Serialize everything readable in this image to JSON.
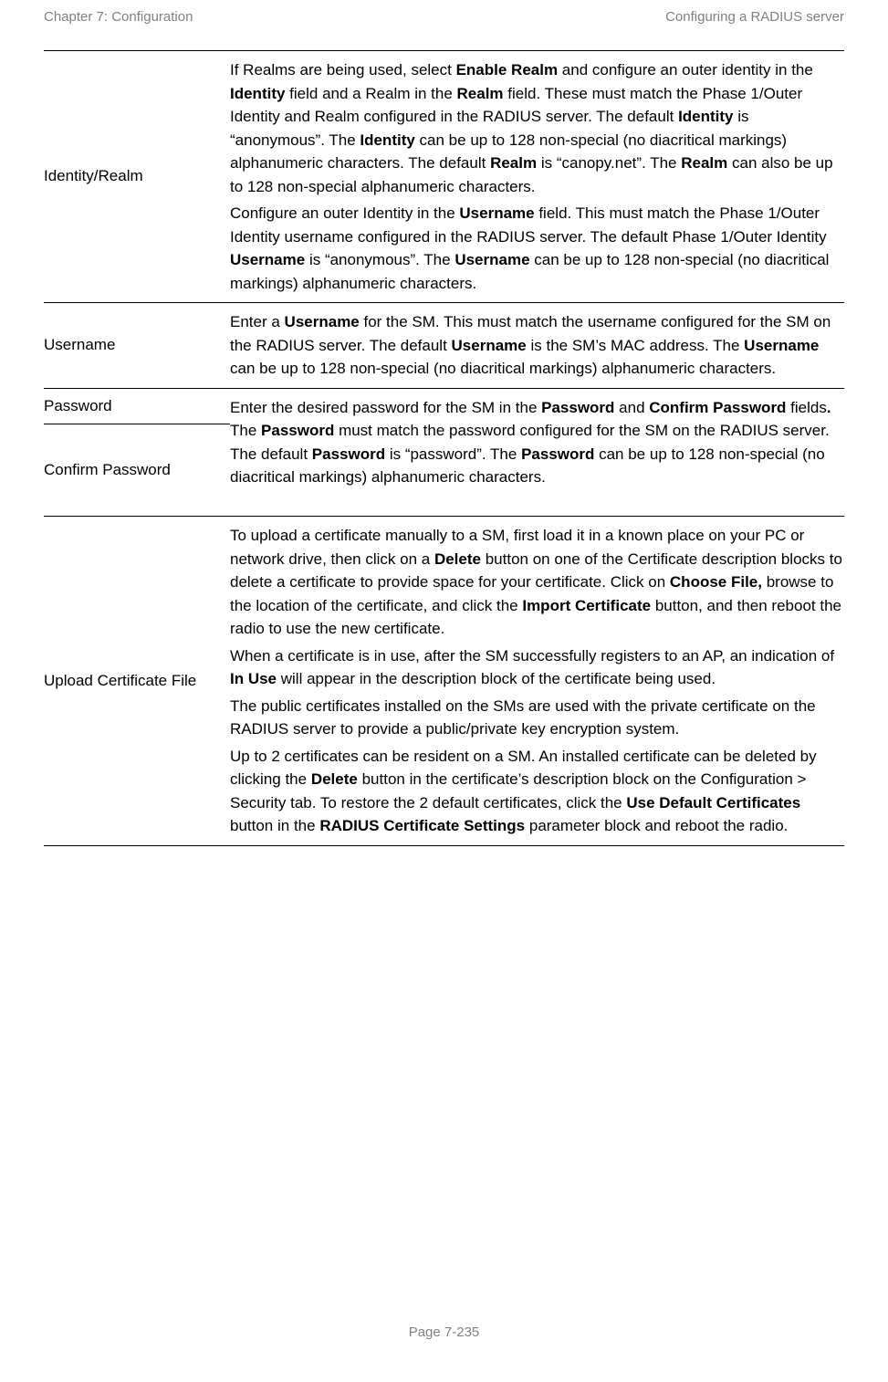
{
  "header": {
    "left": "Chapter 7:  Configuration",
    "right": "Configuring a RADIUS server"
  },
  "rows": {
    "identity": {
      "label": "Identity/Realm",
      "p1_a": "If Realms are being used, select ",
      "p1_b": "Enable Realm",
      "p1_c": " and configure an outer identity in the ",
      "p1_d": "Identity",
      "p1_e": " field and a Realm in the ",
      "p1_f": "Realm",
      "p1_g": " field. These must match the Phase 1/Outer Identity and Realm configured in the RADIUS server. The default ",
      "p1_h": "Identity",
      "p1_i": " is “anonymous”. The ",
      "p1_j": "Identity",
      "p1_k": " can be up to 128 non-special (no diacritical markings) alphanumeric characters. The default ",
      "p1_l": "Realm",
      "p1_m": " is “canopy.net”. The ",
      "p1_n": "Realm",
      "p1_o": " can also be up to 128 non-special alphanumeric characters.",
      "p2_a": "Configure an outer Identity in the ",
      "p2_b": "Username",
      "p2_c": " field. This must match the Phase 1/Outer Identity username configured in the RADIUS server. The default Phase 1/Outer Identity ",
      "p2_d": "Username",
      "p2_e": " is “anonymous”. The ",
      "p2_f": "Username",
      "p2_g": " can be up to 128 non-special (no diacritical markings) alphanumeric characters."
    },
    "username": {
      "label": "Username",
      "p1_a": "Enter a ",
      "p1_b": "Username",
      "p1_c": " for the SM. This must match the username configured for the SM on the RADIUS server. The default ",
      "p1_d": "Username",
      "p1_e": " is the SM’s MAC address. The ",
      "p1_f": "Username",
      "p1_g": " can be up to 128 non-special (no diacritical markings) alphanumeric characters."
    },
    "password": {
      "label1": "Password",
      "label2": "Confirm Password",
      "p1_a": "Enter the desired password for the SM in the ",
      "p1_b": "Password",
      "p1_c": " and ",
      "p1_d": "Confirm Password",
      "p1_e": " fields",
      "p1_f": ".",
      "p1_g": " The ",
      "p1_h": "Password",
      "p1_i": " must match the password configured for the SM on the RADIUS server. The default ",
      "p1_j": "Password",
      "p1_k": " is “password”. The ",
      "p1_l": "Password",
      "p1_m": " can be up to 128 non-special (no diacritical markings) alphanumeric characters."
    },
    "upload": {
      "label": "Upload Certificate File",
      "p1_a": "To upload a certificate manually to a SM, first load it in a known place on your PC or network drive, then click on a ",
      "p1_b": "Delete",
      "p1_c": " button on one of the Certificate description blocks to delete a certificate to provide space for your certificate. Click on ",
      "p1_d": "Choose File,",
      "p1_e": " browse to the location of the certificate, and click the ",
      "p1_f": "Import Certificate",
      "p1_g": " button, and then reboot the radio to use the new certificate.",
      "p2_a": "When a certificate is in use, after the SM successfully registers to an AP, an indication of ",
      "p2_b": "In Use",
      "p2_c": " will appear in the description block of the certificate being used.",
      "p3": "The public certificates installed on the SMs are used with the private certificate on the RADIUS server to provide a public/private key encryption system.",
      "p4_a": "Up to 2 certificates can be resident on a SM. An installed certificate can be deleted by clicking the ",
      "p4_b": "Delete",
      "p4_c": " button in the certificate’s description block on the Configuration > Security tab. To restore the 2 default certificates, click the ",
      "p4_d": "Use Default Certificates",
      "p4_e": " button in the ",
      "p4_f": "RADIUS Certificate Settings",
      "p4_g": " parameter block and reboot the radio."
    }
  },
  "footer": "Page 7-235"
}
